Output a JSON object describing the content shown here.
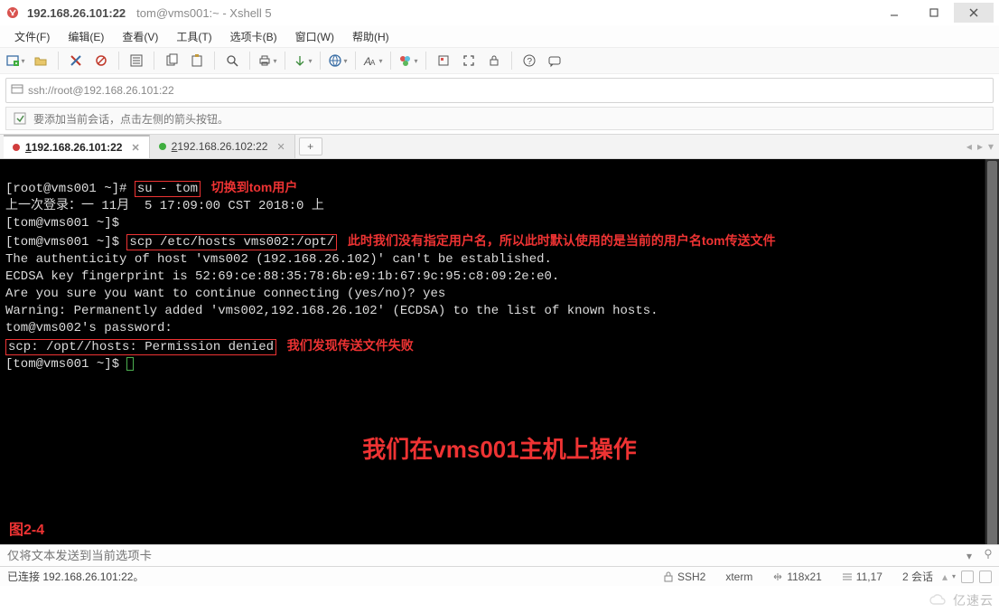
{
  "titlebar": {
    "main": "192.168.26.101:22",
    "sub": "tom@vms001:~ - Xshell 5"
  },
  "menu": {
    "file": "文件(F)",
    "edit": "编辑(E)",
    "view": "查看(V)",
    "tools": "工具(T)",
    "tabs": "选项卡(B)",
    "window": "窗口(W)",
    "help": "帮助(H)"
  },
  "address": "ssh://root@192.168.26.101:22",
  "hint": "要添加当前会话，点击左侧的箭头按钮。",
  "tabs": {
    "t1": {
      "num": "1",
      "label": " 192.168.26.101:22"
    },
    "t2": {
      "num": "2",
      "label": " 192.168.26.102:22"
    },
    "add": "+"
  },
  "term": {
    "l1a": "[root@vms001 ~]# ",
    "l1b": "su - tom",
    "l1c": "   切换到tom用户",
    "l2": "上一次登录：一 11月  5 17:09:00 CST 2018:0 上",
    "l3": "[tom@vms001 ~]$",
    "l4a": "[tom@vms001 ~]$ ",
    "l4b": "scp /etc/hosts vms002:/opt/",
    "l4c": "   此时我们没有指定用户名，所以此时默认使用的是当前的用户名tom传送文件",
    "l5": "The authenticity of host 'vms002 (192.168.26.102)' can't be established.",
    "l6": "ECDSA key fingerprint is 52:69:ce:88:35:78:6b:e9:1b:67:9c:95:c8:09:2e:e0.",
    "l7": "Are you sure you want to continue connecting (yes/no)? yes",
    "l8": "Warning: Permanently added 'vms002,192.168.26.102' (ECDSA) to the list of known hosts.",
    "l9": "tom@vms002's password:",
    "l10a": "scp: /opt//hosts: Permission denied",
    "l10b": "   我们发现传送文件失败",
    "l11": "[tom@vms001 ~]$ ",
    "big": "我们在vms001主机上操作",
    "fig": "图2-4"
  },
  "sendbar": {
    "placeholder": "仅将文本发送到当前选项卡"
  },
  "status": {
    "conn": "已连接 192.168.26.101:22。",
    "proto": "SSH2",
    "term": "xterm",
    "size": "118x21",
    "pos": "11,17",
    "sessions": "2 会话"
  },
  "watermark": "亿速云"
}
